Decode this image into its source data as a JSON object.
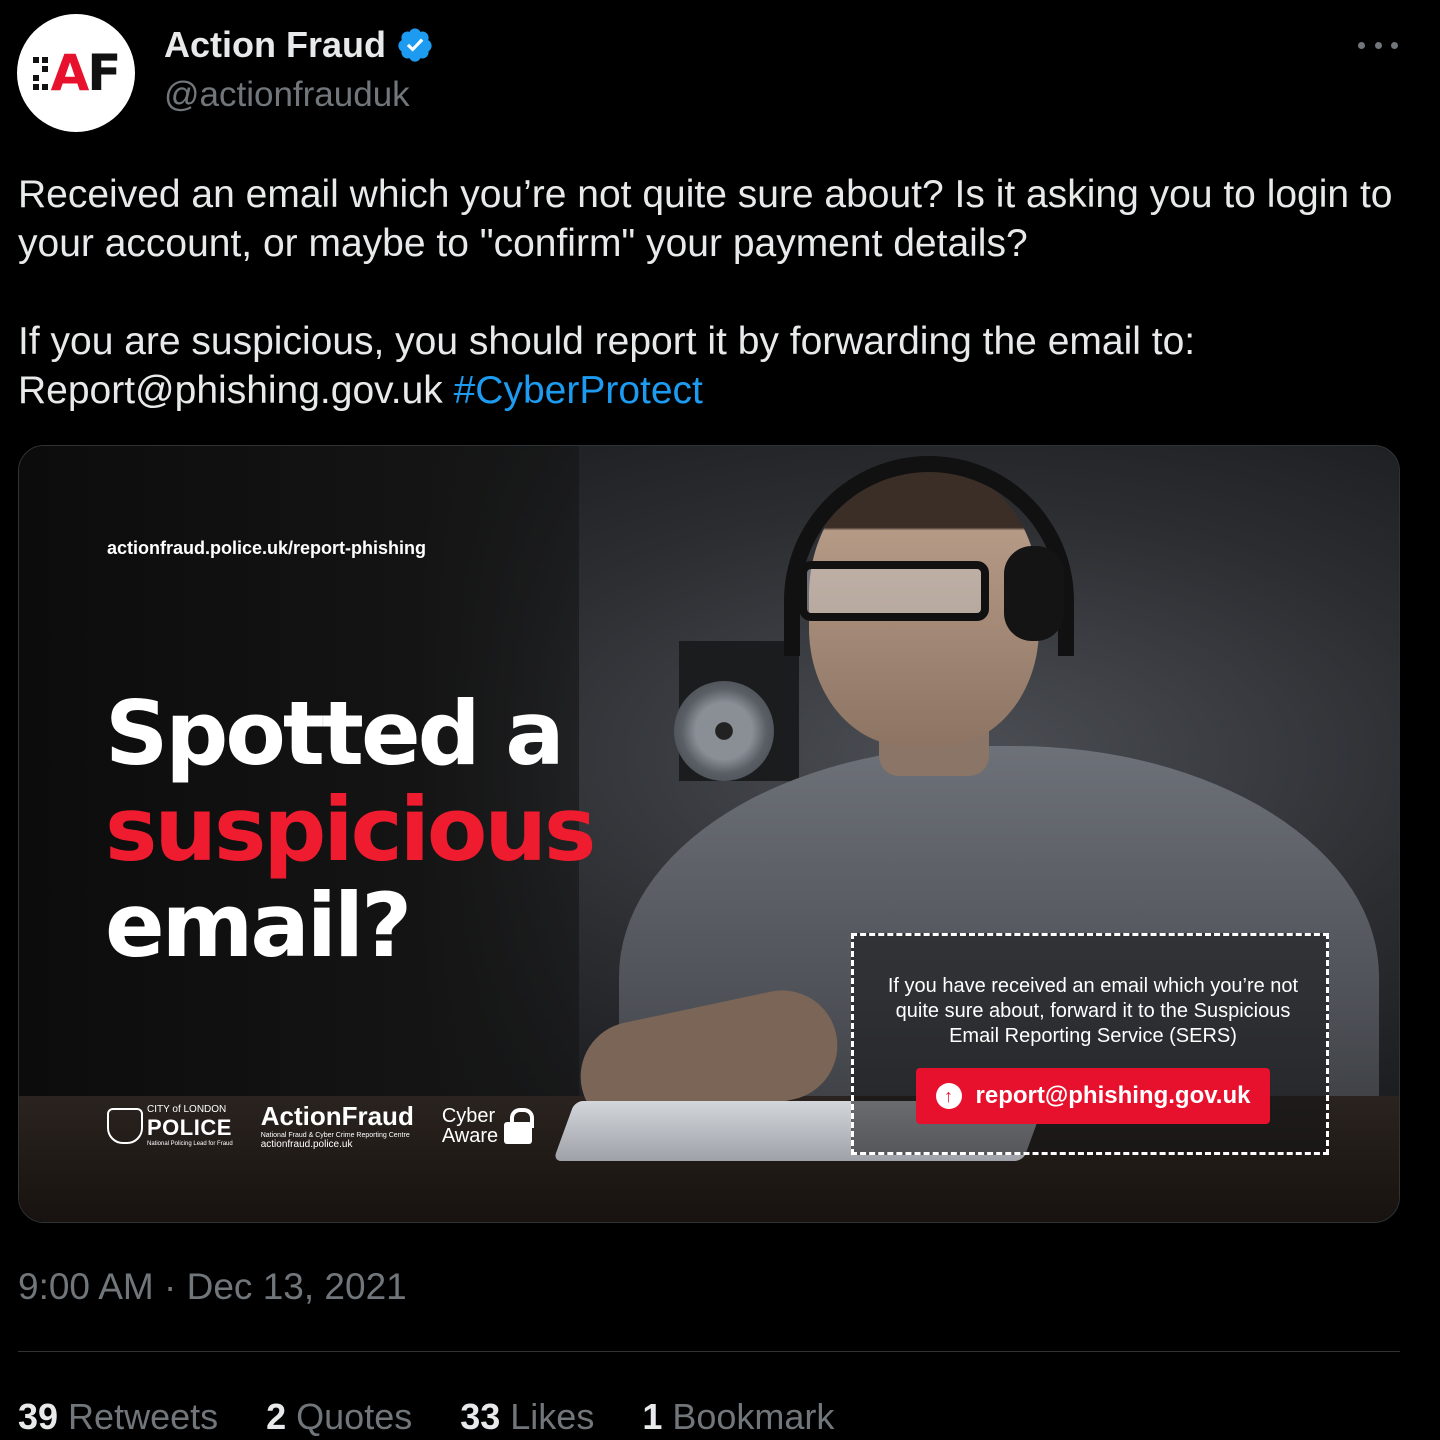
{
  "author": {
    "display_name": "Action Fraud",
    "handle": "@actionfrauduk",
    "verified": true,
    "avatar_icon": "action-fraud-logo",
    "avatar_text": "AF"
  },
  "tweet": {
    "paragraph_1": "Received an email which you’re not quite sure about?  Is it asking you to login to your account, or maybe to \"confirm\" your payment details?",
    "paragraph_2_text": "If you are suspicious, you should report it by forwarding the email to: Report@phishing.gov.uk ",
    "hashtag": "#CyberProtect"
  },
  "media": {
    "url": "actionfraud.police.uk/report-phishing",
    "headline_line1": "Spotted a",
    "headline_line2": "suspicious",
    "headline_line3": "email?",
    "sers_text": "If you have received an email which you’re not quite sure about, forward it to the Suspicious Email Reporting Service (SERS)",
    "sers_button": "report@phishing.gov.uk",
    "logos": {
      "police_small": "CITY of LONDON",
      "police_big": "POLICE",
      "police_tiny": "National Policing Lead for Fraud",
      "af_big": "ActionFraud",
      "af_tiny": "National Fraud & Cyber Crime Reporting Centre",
      "af_url": "actionfraud.police.uk",
      "cyber_line1": "Cyber",
      "cyber_line2": "Aware"
    }
  },
  "timestamp": "9:00 AM · Dec 13, 2021",
  "stats": [
    {
      "num": "39",
      "label": "Retweets"
    },
    {
      "num": "2",
      "label": "Quotes"
    },
    {
      "num": "33",
      "label": "Likes"
    },
    {
      "num": "1",
      "label": "Bookmark"
    }
  ],
  "colors": {
    "background": "#000000",
    "accent_blue": "#1d9bf0",
    "brand_red": "#e8112d",
    "muted_text": "#71767b"
  }
}
